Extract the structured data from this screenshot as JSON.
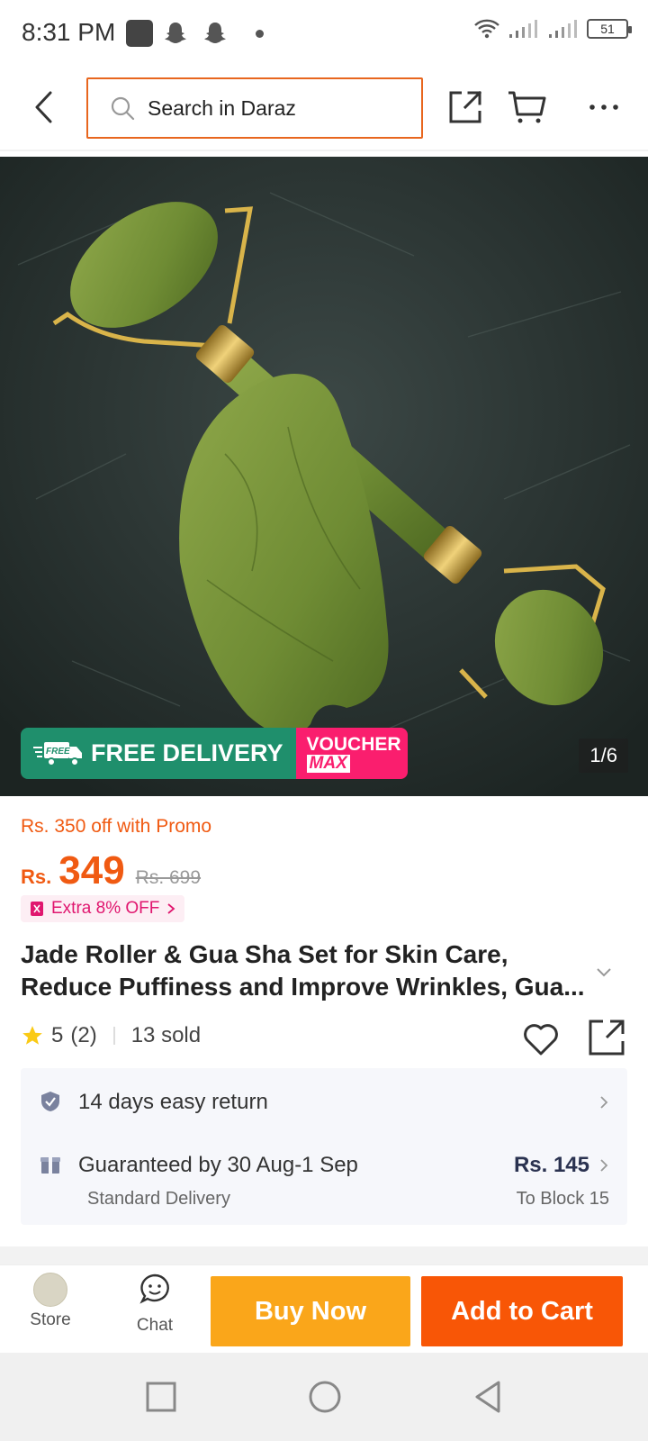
{
  "status_bar": {
    "time": "8:31 PM",
    "battery": "51"
  },
  "header": {
    "search_placeholder": "Search in Daraz"
  },
  "gallery": {
    "counter": "1/6",
    "free_delivery": "FREE DELIVERY",
    "free_badge": "FREE",
    "voucher_line1": "VOUCHER",
    "voucher_line2": "MAX"
  },
  "product": {
    "promo": "Rs. 350 off with Promo",
    "currency": "Rs.",
    "price": "349",
    "old_price": "Rs. 699",
    "extra_off": "Extra 8% OFF",
    "title_line1": "Jade Roller & Gua Sha Set for Skin Care,",
    "title_line2": "Reduce Puffiness and Improve Wrinkles, Gua...",
    "rating": "5",
    "rating_count": "(2)",
    "sold": "13 sold"
  },
  "services": {
    "return_label": "14 days easy return",
    "delivery_label": "Guaranteed by 30 Aug-1 Sep",
    "delivery_type": "Standard Delivery",
    "delivery_fee": "Rs. 145",
    "delivery_to": "To Block 15"
  },
  "actions": {
    "store": "Store",
    "chat": "Chat",
    "buy_now": "Buy Now",
    "add_to_cart": "Add to Cart"
  },
  "colors": {
    "accent": "#f85606",
    "buy_now": "#faa61a",
    "free_delivery": "#1f8f6c",
    "voucher": "#fa1e6e"
  }
}
